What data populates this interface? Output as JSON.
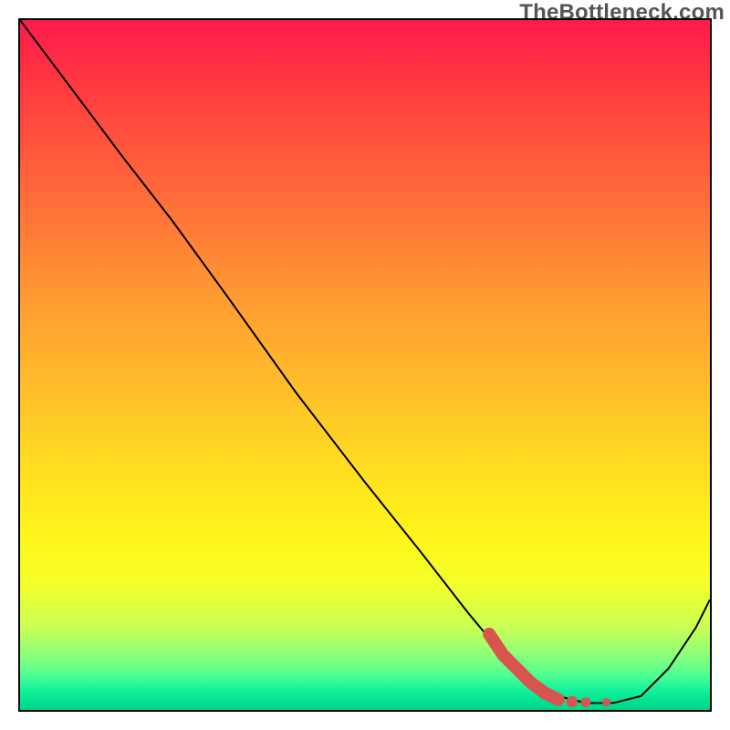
{
  "watermark": "TheBottleneck.com",
  "chart_data": {
    "type": "line",
    "title": "",
    "xlabel": "",
    "ylabel": "",
    "xlim": [
      0,
      100
    ],
    "ylim": [
      0,
      100
    ],
    "grid": false,
    "legend": false,
    "series": [
      {
        "name": "black-curve",
        "x": [
          0,
          6,
          15,
          22,
          30,
          40,
          50,
          58,
          65,
          70,
          74,
          78,
          82,
          86,
          90,
          94,
          98,
          100
        ],
        "values": [
          100,
          92,
          80,
          71,
          60,
          46,
          33,
          23,
          14,
          8,
          4,
          2,
          1,
          1,
          2,
          6,
          12,
          16
        ],
        "color": "#000000"
      },
      {
        "name": "accent-highlight",
        "x": [
          68,
          70,
          72,
          74,
          76,
          78,
          80,
          82,
          85
        ],
        "values": [
          11,
          8,
          6,
          4,
          2.5,
          1.5,
          1.2,
          1.1,
          1.1
        ],
        "color": "#d9534f",
        "style": "thick-with-dots"
      }
    ],
    "gradient_background": {
      "orientation": "vertical",
      "stops": [
        {
          "pos": 0.0,
          "color": "#ff1a4d"
        },
        {
          "pos": 0.25,
          "color": "#ff6a3a"
        },
        {
          "pos": 0.55,
          "color": "#ffc229"
        },
        {
          "pos": 0.75,
          "color": "#fff61a"
        },
        {
          "pos": 0.92,
          "color": "#8dff78"
        },
        {
          "pos": 1.0,
          "color": "#00d488"
        }
      ]
    }
  }
}
